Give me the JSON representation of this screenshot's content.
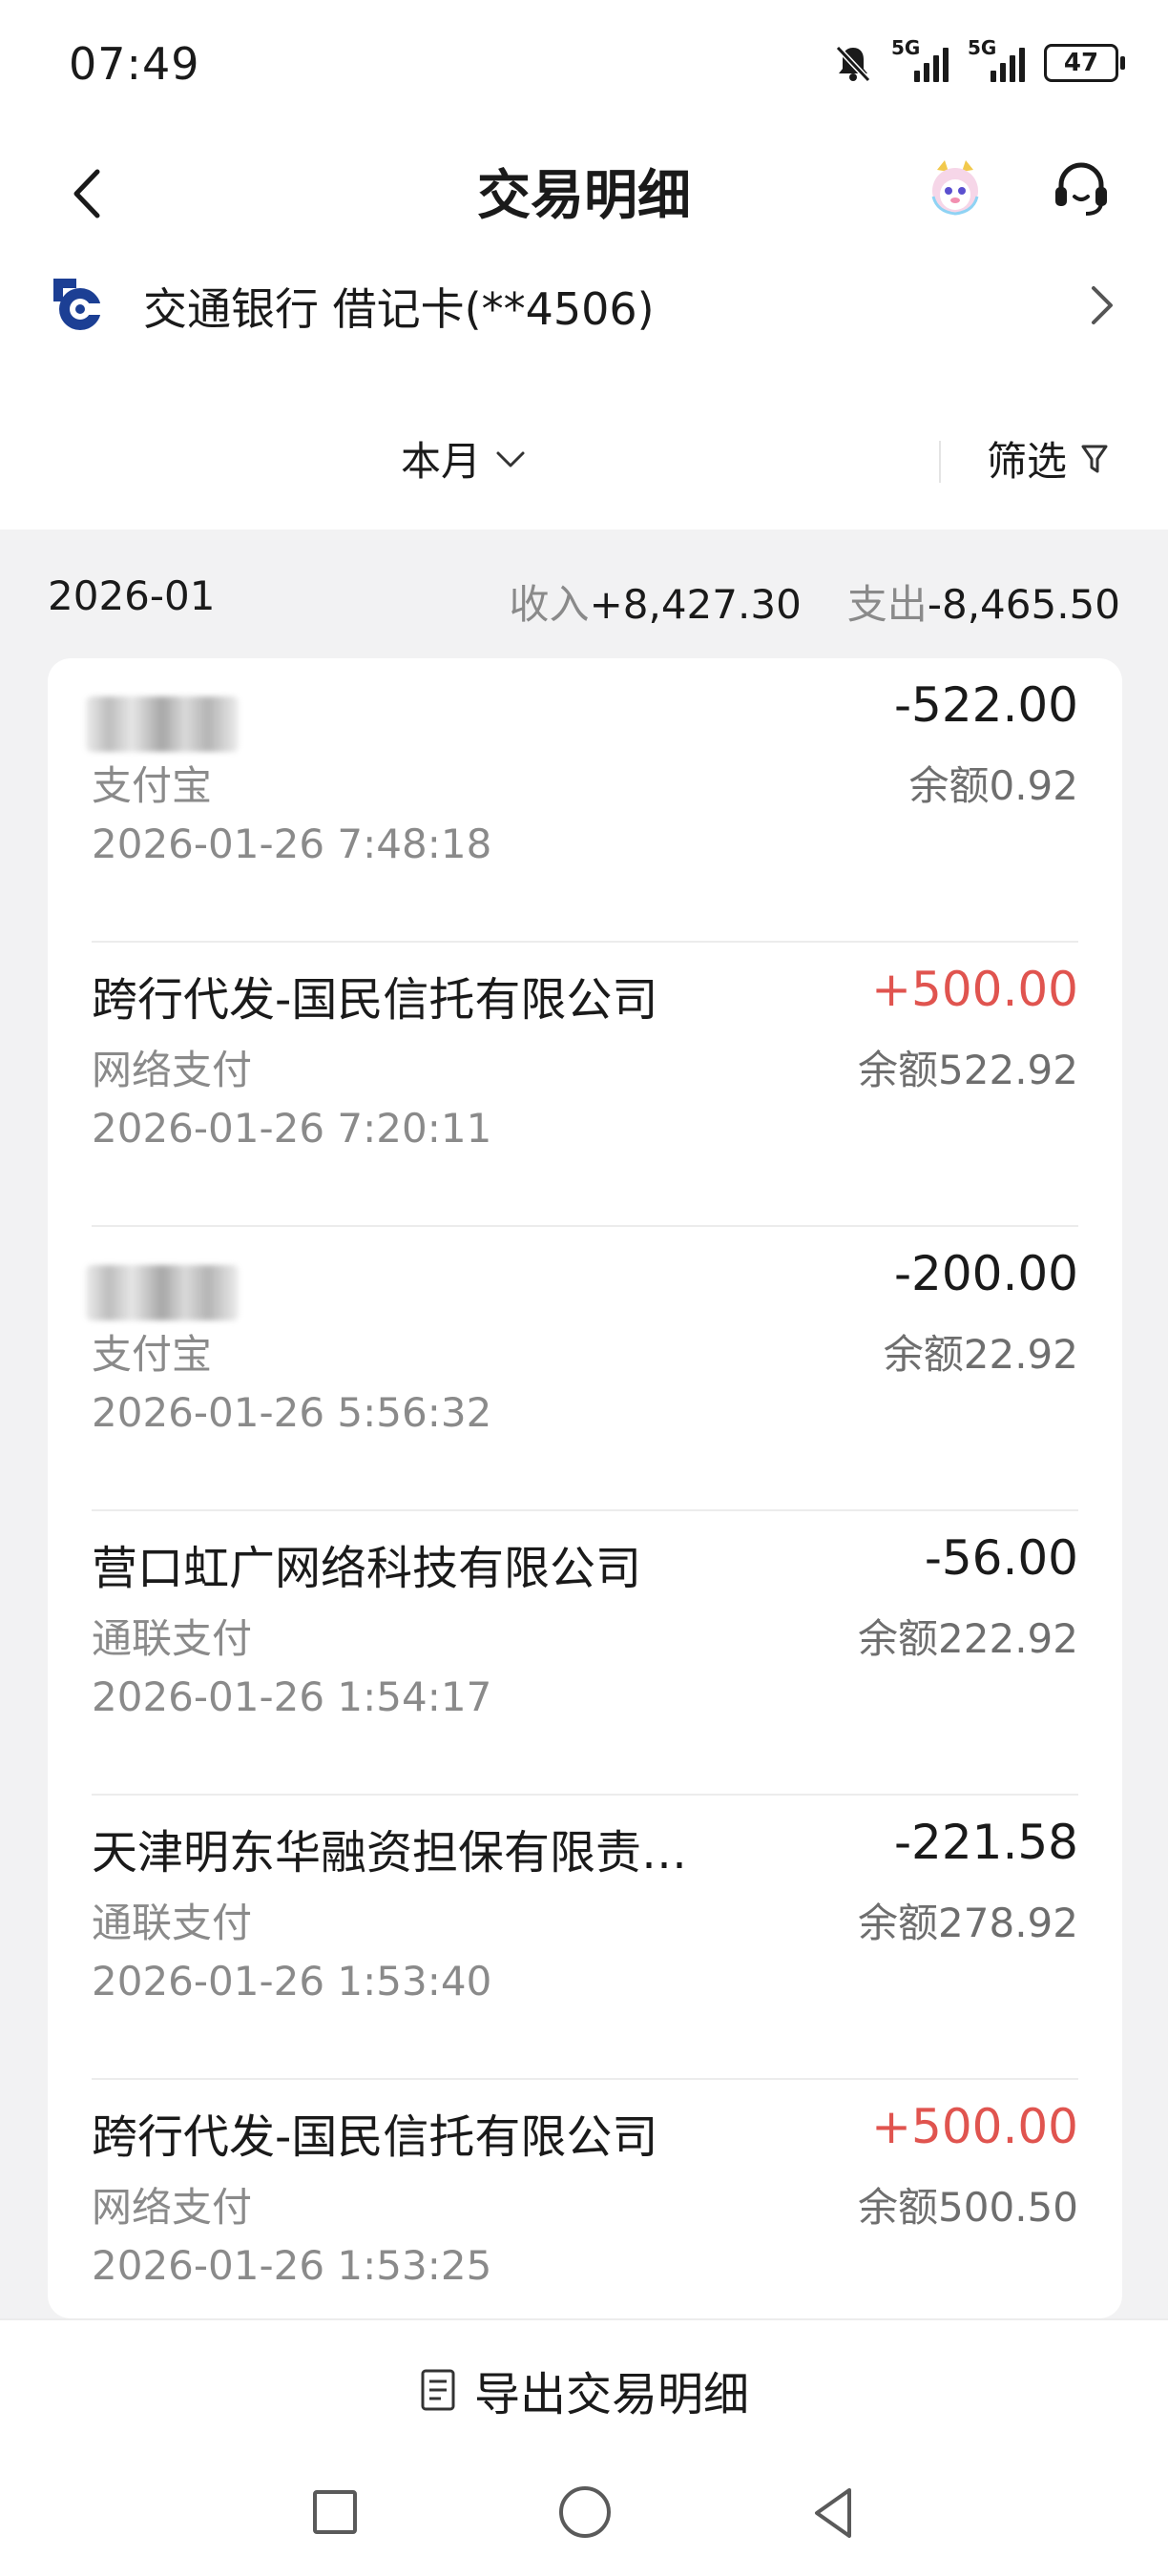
{
  "status_bar": {
    "time": "07:49",
    "network1": "5G",
    "network2": "5G",
    "battery": "47",
    "icons": [
      "bell-off-icon",
      "signal-icon",
      "signal-icon",
      "battery-icon"
    ]
  },
  "header": {
    "title": "交易明细",
    "icons": [
      "back-arrow-icon",
      "mascot-icon",
      "headset-icon"
    ]
  },
  "account": {
    "bank_name": "交通银行 借记卡(**4506)"
  },
  "filter": {
    "period": "本月",
    "filter_label": "筛选"
  },
  "summary": {
    "month": "2026-01",
    "income_label": "收入",
    "income_value": "+8,427.30",
    "expense_label": "支出",
    "expense_value": "-8,465.50"
  },
  "transactions": [
    {
      "name": "",
      "channel": "支付宝",
      "time": "2026-01-26 7:48:18",
      "amount": "-522.00",
      "balance": "余额0.92",
      "income": false
    },
    {
      "name": "跨行代发-国民信托有限公司",
      "channel": "网络支付",
      "time": "2026-01-26 7:20:11",
      "amount": "+500.00",
      "balance": "余额522.92",
      "income": true
    },
    {
      "name": "",
      "channel": "支付宝",
      "time": "2026-01-26 5:56:32",
      "amount": "-200.00",
      "balance": "余额22.92",
      "income": false
    },
    {
      "name": "营口虹广网络科技有限公司",
      "channel": "通联支付",
      "time": "2026-01-26 1:54:17",
      "amount": "-56.00",
      "balance": "余额222.92",
      "income": false
    },
    {
      "name": "天津明东华融资担保有限责…",
      "channel": "通联支付",
      "time": "2026-01-26 1:53:40",
      "amount": "-221.58",
      "balance": "余额278.92",
      "income": false
    },
    {
      "name": "跨行代发-国民信托有限公司",
      "channel": "网络支付",
      "time": "2026-01-26 1:53:25",
      "amount": "+500.00",
      "balance": "余额500.50",
      "income": true
    }
  ],
  "export": {
    "label": "导出交易明细"
  },
  "colors": {
    "income": "#e0544f",
    "text": "#1a1a1a",
    "muted": "#8a8a8a",
    "background": "#f2f2f3"
  }
}
